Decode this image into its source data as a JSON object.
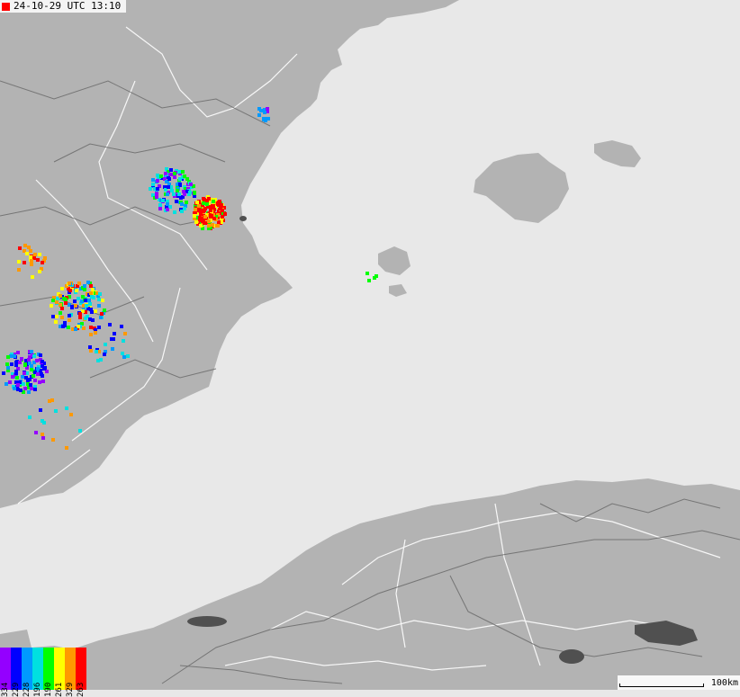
{
  "timestamp": "24-10-29 UTC 13:10",
  "scale_label": "100km",
  "legend": [
    {
      "label": "334",
      "color": "#9400ff"
    },
    {
      "label": "229",
      "color": "#0000ff"
    },
    {
      "label": "228",
      "color": "#0099ff"
    },
    {
      "label": "196",
      "color": "#00e0e0"
    },
    {
      "label": "190",
      "color": "#00ff00"
    },
    {
      "label": "261",
      "color": "#ffff00"
    },
    {
      "label": "329",
      "color": "#ff9900"
    },
    {
      "label": "263",
      "color": "#ff0000"
    }
  ],
  "colors": {
    "sea": "#e8e8e8",
    "land": "#b3b3b3",
    "lakes": "#505050"
  }
}
